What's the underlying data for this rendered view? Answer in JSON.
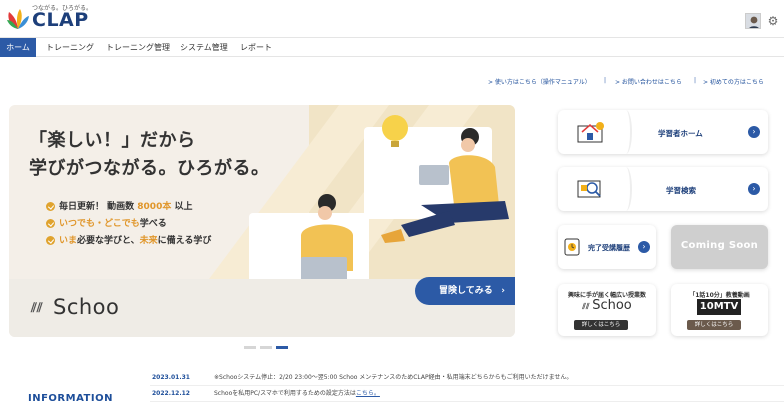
{
  "header": {
    "logo_tagline": "つながる。ひろがる。",
    "logo_word": "CLAP"
  },
  "nav": [
    {
      "label": "ホーム",
      "active": true
    },
    {
      "label": "トレーニング",
      "active": false
    },
    {
      "label": "トレーニング管理",
      "active": false
    },
    {
      "label": "システム管理",
      "active": false
    },
    {
      "label": "レポート",
      "active": false
    }
  ],
  "help_links": [
    "> 使い方はこちら（操作マニュアル）",
    "> お問い合わせはこちら",
    "> 初めての方はこちら"
  ],
  "hero": {
    "title_line1": "「楽しい！」だから",
    "title_line2": "学びがつながる。ひろがる。",
    "bullets": [
      {
        "pre": "毎日更新！ 動画数 ",
        "hl": "8000本",
        "post": " 以上"
      },
      {
        "pre": "",
        "hl": "いつでも・どこでも",
        "post": "学べる"
      },
      {
        "pre": "",
        "hl": "いま",
        "post": "必要な学びと、",
        "hl2": "未来",
        "post2": "に備える学び"
      }
    ],
    "brand": "Schoo",
    "cta": "冒険してみる",
    "cta_arrow": "›"
  },
  "cards": {
    "learner_home": "学習者ホーム",
    "learning_search": "学習検索",
    "completed_history": "完了受講履歴",
    "coming_soon": "Coming Soon",
    "arrow": "›"
  },
  "promos": [
    {
      "head": "興味に手が届く幅広い授業数",
      "brand": "Schoo",
      "button": "詳しくはこちら"
    },
    {
      "head": "「1話10分」教養動画",
      "brand": "10MTV",
      "button": "詳しくはこちら"
    }
  ],
  "news": [
    {
      "date": "2023.01.31",
      "text": "※Schooシステム停止：2/20 23:00～翌5:00 Schoo メンテナンスのためCLAP経由・私用端末どちらからもご利用いただけません。",
      "link": ""
    },
    {
      "date": "2022.12.12",
      "text": "Schooを私用PC/スマホで利用するための設定方法は",
      "link": "こちら。"
    }
  ],
  "info_label": "INFORMATION",
  "colors": {
    "brand_blue": "#2c5aa6",
    "accent_orange": "#e0962a",
    "hero_bg": "#f4efe8"
  }
}
